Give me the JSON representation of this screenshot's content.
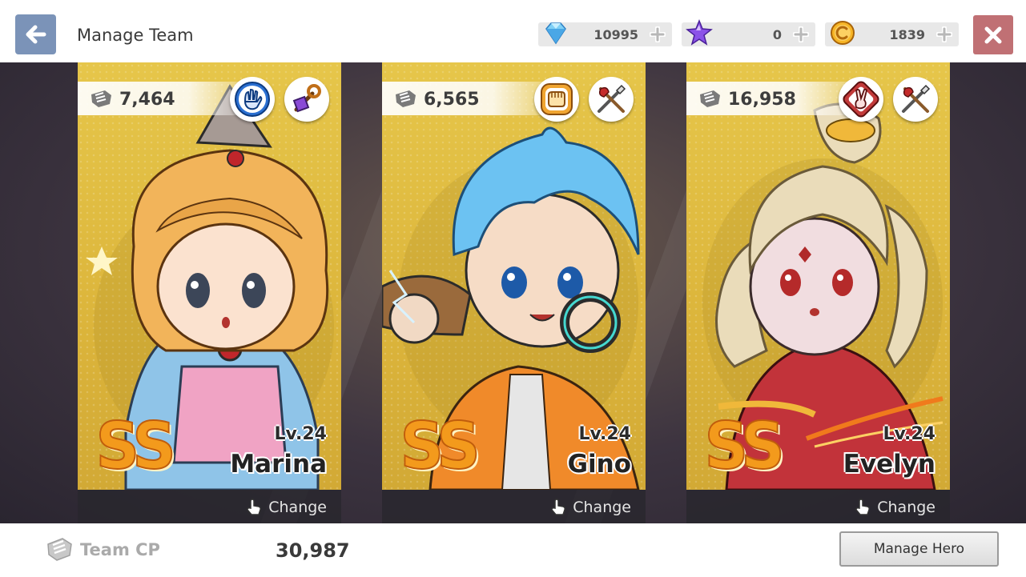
{
  "header": {
    "title": "Manage Team",
    "back_icon": "arrow-left-icon",
    "close_icon": "close-icon",
    "resources": [
      {
        "name": "diamond",
        "icon": "diamond-gem-icon",
        "value": "10995",
        "color": "#6fc3f0"
      },
      {
        "name": "star-crystal",
        "icon": "purple-star-icon",
        "value": "0",
        "color": "#9c5cf0"
      },
      {
        "name": "gold",
        "icon": "gold-coin-icon",
        "value": "1839",
        "color": "#f2a81d"
      }
    ]
  },
  "heroes": [
    {
      "cp": "7,464",
      "grade": "SS",
      "level": "Lv.24",
      "name": "Marina",
      "change_label": "Change",
      "badges": [
        "paper-hand-element-icon",
        "magic-staff-class-icon"
      ],
      "hair": "#f2b45a",
      "outfit": "#8fc4e8"
    },
    {
      "cp": "6,565",
      "grade": "SS",
      "level": "Lv.24",
      "name": "Gino",
      "change_label": "Change",
      "badges": [
        "rock-fist-element-icon",
        "axe-sword-class-icon"
      ],
      "hair": "#6cc2f2",
      "outfit": "#f08a2a"
    },
    {
      "cp": "16,958",
      "grade": "SS",
      "level": "Lv.24",
      "name": "Evelyn",
      "change_label": "Change",
      "badges": [
        "scissors-hand-element-icon",
        "axe-sword-class-icon"
      ],
      "hair": "#eadcba",
      "outfit": "#c2333a"
    }
  ],
  "footer": {
    "team_cp_label": "Team CP",
    "team_cp_value": "30,987",
    "manage_hero_label": "Manage Hero"
  },
  "colors": {
    "back_button": "#7b93b8",
    "close_button": "#c07074",
    "grade": "#f39a1c",
    "card_bg": "#e2bf45"
  }
}
